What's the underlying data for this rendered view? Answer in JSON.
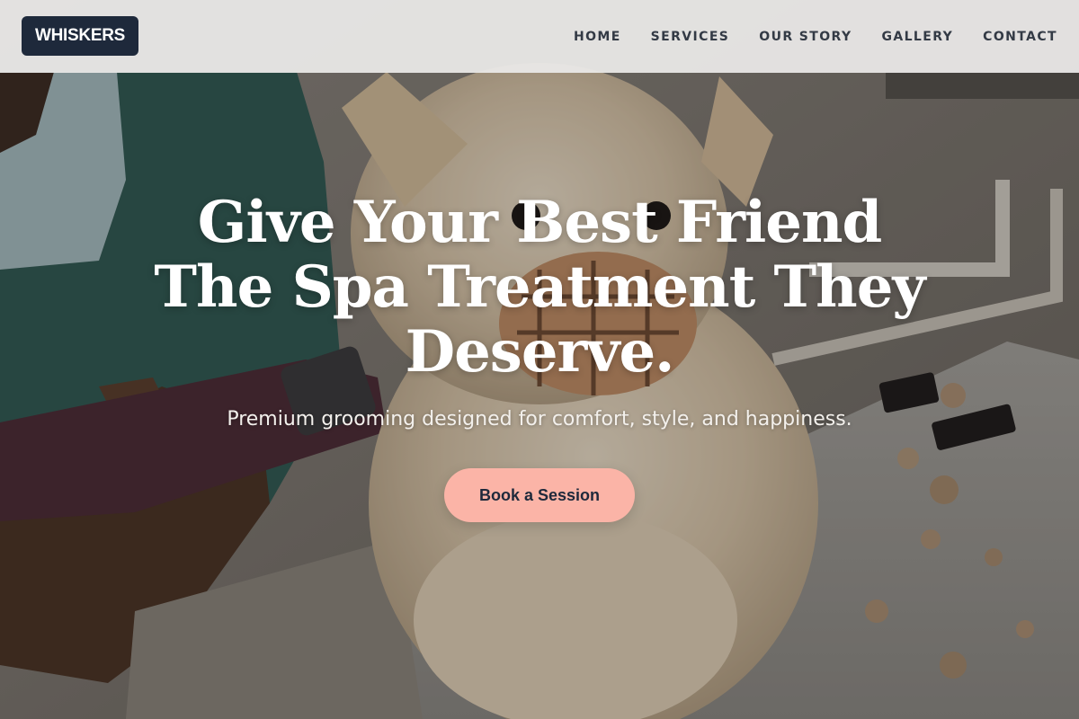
{
  "brand": {
    "logo_text": "WHISKERS",
    "logo_bg_color": "#1e293b"
  },
  "nav": {
    "items": [
      {
        "label": "HOME"
      },
      {
        "label": "SERVICES"
      },
      {
        "label": "OUR STORY"
      },
      {
        "label": "GALLERY"
      },
      {
        "label": "CONTACT"
      }
    ]
  },
  "hero": {
    "title_lines": [
      "Give Your Best Friend",
      "The Spa Treatment They",
      "Deserve."
    ],
    "subtitle": "Premium grooming designed for comfort, style, and happiness.",
    "cta_label": "Book a Session",
    "cta_color": "#fbb4a7",
    "background_image": "dog-grooming-photo"
  }
}
